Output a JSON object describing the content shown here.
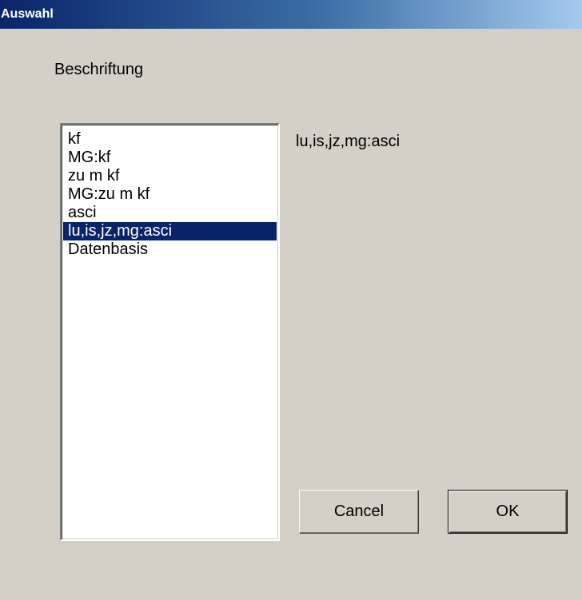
{
  "window": {
    "title": "Auswahl"
  },
  "caption": "Beschriftung",
  "list": {
    "items": [
      "kf",
      "MG:kf",
      "zu m kf",
      "MG:zu m kf",
      "asci",
      "lu,is,jz,mg:asci",
      "Datenbasis"
    ],
    "selected_index": 5
  },
  "selected_value": "lu,is,jz,mg:asci",
  "buttons": {
    "cancel_label": "Cancel",
    "ok_label": "OK"
  },
  "colors": {
    "dialog_background": "#d4d0c8",
    "title_gradient_start": "#0a246a",
    "title_gradient_end": "#a6caf0",
    "selection_background": "#0a246a",
    "selection_text": "#ffffff"
  }
}
